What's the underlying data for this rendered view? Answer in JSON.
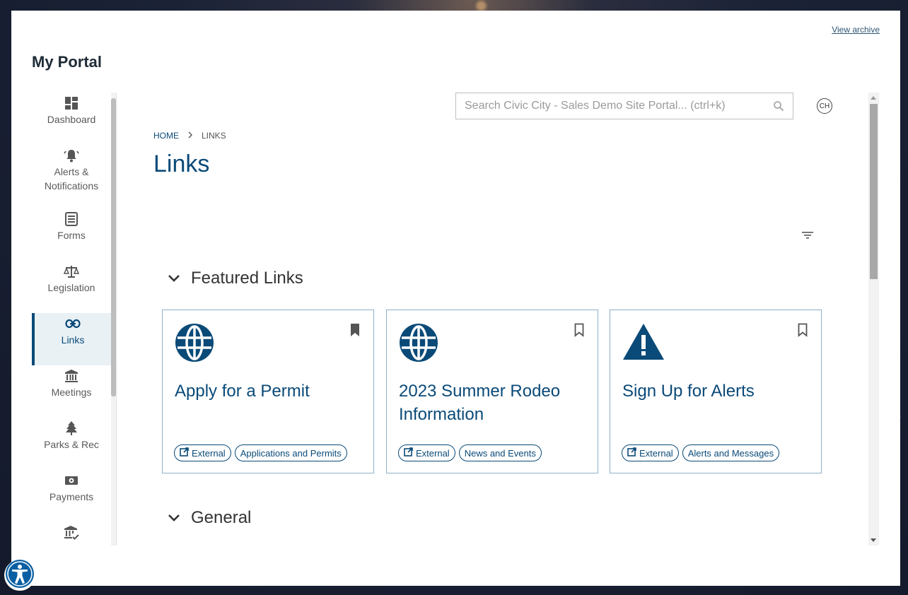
{
  "header": {
    "view_archive": "View archive",
    "portal_title": "My Portal"
  },
  "sidebar": {
    "items": [
      {
        "label": "Dashboard",
        "icon": "dashboard-icon"
      },
      {
        "label": "Alerts & Notifications",
        "icon": "bell-icon"
      },
      {
        "label": "Forms",
        "icon": "form-icon"
      },
      {
        "label": "Legislation",
        "icon": "scales-icon"
      },
      {
        "label": "Links",
        "icon": "link-icon",
        "active": true
      },
      {
        "label": "Meetings",
        "icon": "bank-icon"
      },
      {
        "label": "Parks & Rec",
        "icon": "tree-icon"
      },
      {
        "label": "Payments",
        "icon": "money-icon"
      },
      {
        "label": "",
        "icon": "bank-check-icon"
      }
    ]
  },
  "search": {
    "placeholder": "Search Civic City - Sales Demo Site Portal... (ctrl+k)",
    "value": ""
  },
  "user": {
    "initials": "CH"
  },
  "breadcrumb": {
    "home": "HOME",
    "current": "LINKS"
  },
  "page": {
    "title": "Links"
  },
  "sections": {
    "featured": {
      "title": "Featured Links"
    },
    "general": {
      "title": "General"
    }
  },
  "cards": [
    {
      "title": "Apply for a Permit",
      "icon": "globe-icon",
      "bookmarked": true,
      "tags": [
        "External",
        "Applications and Permits"
      ]
    },
    {
      "title": "2023 Summer Rodeo Information",
      "icon": "globe-icon",
      "bookmarked": false,
      "tags": [
        "External",
        "News and Events"
      ]
    },
    {
      "title": "Sign Up for Alerts",
      "icon": "warning-icon",
      "bookmarked": false,
      "tags": [
        "External",
        "Alerts and Messages"
      ]
    }
  ],
  "colors": {
    "accent": "#0a4a78",
    "card_border": "#8fb0c8",
    "active_bg": "#e9f1f5"
  }
}
